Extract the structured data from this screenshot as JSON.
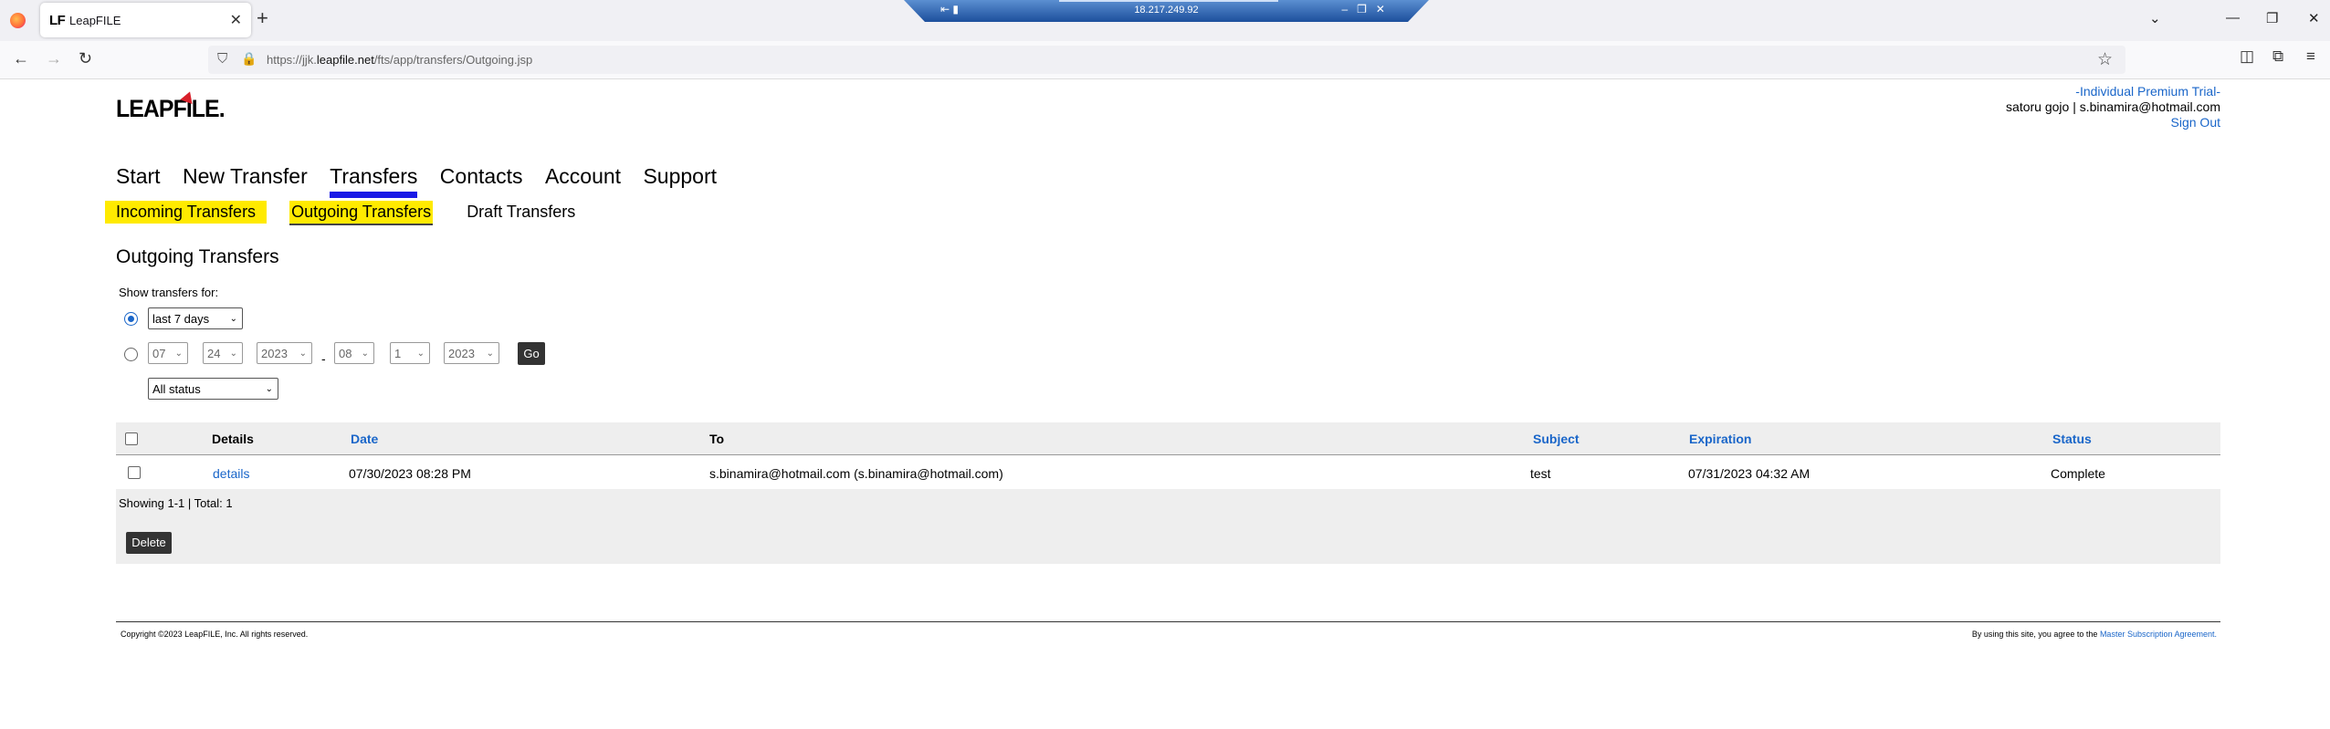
{
  "browser": {
    "tab_favicon": "LF",
    "tab_title": "LeapFILE",
    "tab_close": "✕",
    "new_tab": "+",
    "url_prefix": "https://jjk.",
    "url_domain": "leapfile.net",
    "url_path": "/fts/app/transfers/Outgoing.jsp",
    "remote_ip": "18.217.249.92"
  },
  "header": {
    "logo": "LEAPFILE.",
    "trial_link": "-Individual Premium Trial-",
    "user": "satoru gojo | s.binamira@hotmail.com",
    "signout": "Sign Out"
  },
  "nav": {
    "items": [
      "Start",
      "New Transfer",
      "Transfers",
      "Contacts",
      "Account",
      "Support"
    ],
    "active": "Transfers"
  },
  "subnav": {
    "incoming": "Incoming Transfers",
    "outgoing": "Outgoing Transfers",
    "draft": "Draft Transfers"
  },
  "main": {
    "title": "Outgoing Transfers",
    "show_for": "Show transfers for:",
    "period_select": "last 7 days",
    "from_month": "07",
    "from_day": "24",
    "from_year": "2023",
    "dash": "-",
    "to_month": "08",
    "to_day": "1",
    "to_year": "2023",
    "go": "Go",
    "status_select": "All status"
  },
  "table": {
    "headers": {
      "details": "Details",
      "date": "Date",
      "to": "To",
      "subject": "Subject",
      "expiration": "Expiration",
      "status": "Status"
    },
    "rows": [
      {
        "details": "details",
        "date": "07/30/2023 08:28 PM",
        "to": "s.binamira@hotmail.com (s.binamira@hotmail.com)",
        "subject": "test",
        "expiration": "07/31/2023 04:32 AM",
        "status": "Complete"
      }
    ],
    "showing": "Showing 1-1 | Total: 1",
    "delete": "Delete"
  },
  "footer": {
    "copyright": "Copyright ©2023 LeapFILE, Inc. All rights reserved.",
    "agree_prefix": "By using this site, you agree to the ",
    "agree_link": "Master Subscription Agreement."
  },
  "colors": {
    "link": "#1a66c9",
    "highlight": "#ffea00",
    "active_underline": "#1a1ae6"
  }
}
